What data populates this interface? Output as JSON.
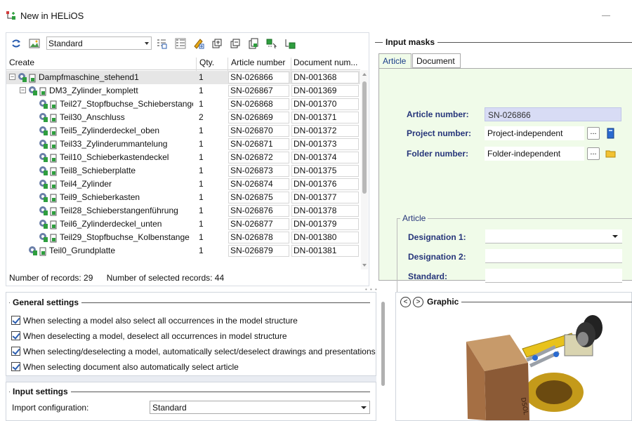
{
  "window": {
    "title": "New in HELiOS"
  },
  "toolbar": {
    "config_value": "Standard"
  },
  "grid": {
    "columns": [
      "Create",
      "Qty.",
      "Article number",
      "Document num..."
    ],
    "rows": [
      {
        "name": "Dampfmaschine_stehend1",
        "qty": "1",
        "article": "SN-026866",
        "document": "DN-001368"
      },
      {
        "name": "DM3_Zylinder_komplett",
        "qty": "1",
        "article": "SN-026867",
        "document": "DN-001369"
      },
      {
        "name": "Teil27_Stopfbuchse_Schieberstange",
        "qty": "1",
        "article": "SN-026868",
        "document": "DN-001370"
      },
      {
        "name": "Teil30_Anschluss",
        "qty": "2",
        "article": "SN-026869",
        "document": "DN-001371"
      },
      {
        "name": "Teil5_Zylinderdeckel_oben",
        "qty": "1",
        "article": "SN-026870",
        "document": "DN-001372"
      },
      {
        "name": "Teil33_Zylinderummantelung",
        "qty": "1",
        "article": "SN-026871",
        "document": "DN-001373"
      },
      {
        "name": "Teil10_Schieberkastendeckel",
        "qty": "1",
        "article": "SN-026872",
        "document": "DN-001374"
      },
      {
        "name": "Teil8_Schieberplatte",
        "qty": "1",
        "article": "SN-026873",
        "document": "DN-001375"
      },
      {
        "name": "Teil4_Zylinder",
        "qty": "1",
        "article": "SN-026874",
        "document": "DN-001376"
      },
      {
        "name": "Teil9_Schieberkasten",
        "qty": "1",
        "article": "SN-026875",
        "document": "DN-001377"
      },
      {
        "name": "Teil28_Schieberstangenführung",
        "qty": "1",
        "article": "SN-026876",
        "document": "DN-001378"
      },
      {
        "name": "Teil6_Zylinderdeckel_unten",
        "qty": "1",
        "article": "SN-026877",
        "document": "DN-001379"
      },
      {
        "name": "Teil29_Stopfbuchse_Kolbenstange",
        "qty": "1",
        "article": "SN-026878",
        "document": "DN-001380"
      },
      {
        "name": "Teil0_Grundplatte",
        "qty": "1",
        "article": "SN-026879",
        "document": "DN-001381"
      }
    ]
  },
  "status": {
    "records": "Number of records: 29",
    "selected": "Number of selected records: 44"
  },
  "input_masks": {
    "title": "Input masks",
    "tabs": [
      "Article",
      "Document"
    ],
    "article_number_label": "Article number:",
    "article_number_value": "SN-026866",
    "project_number_label": "Project number:",
    "project_number_value": "Project-independent",
    "folder_number_label": "Folder number:",
    "folder_number_value": "Folder-independent",
    "browse_label": "...",
    "group_title": "Article",
    "designation1_label": "Designation 1:",
    "designation2_label": "Designation 2:",
    "standard_label": "Standard:"
  },
  "general_settings": {
    "title": "General settings",
    "options": [
      "When selecting a model also select all occurrences in the model structure",
      "When deselecting a model, deselect all occurrences in model structure",
      "When selecting/deselecting a model, automatically select/deselect drawings and presentations",
      "When selecting document also automatically select article"
    ]
  },
  "input_settings": {
    "title": "Input settings",
    "import_config_label": "Import configuration:",
    "import_config_value": "Standard"
  },
  "graphic": {
    "title": "Graphic",
    "part_label": "DSOL"
  },
  "colors": {
    "mask_bg": "#f0fbe9",
    "label_blue": "#26357a",
    "field_blue": "#d8dcf5"
  }
}
